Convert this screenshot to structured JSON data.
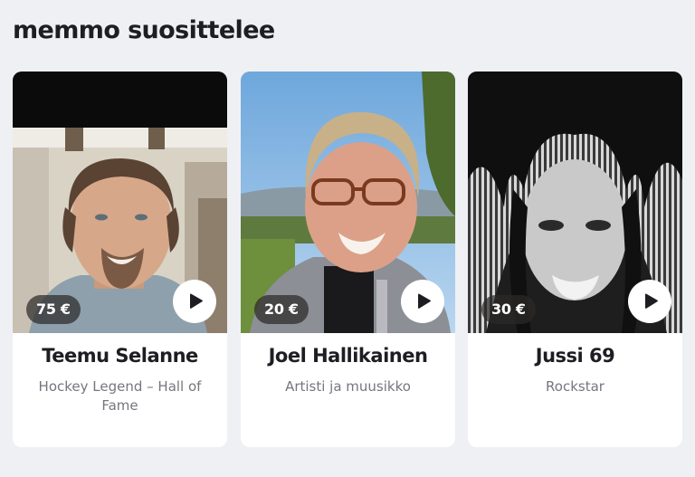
{
  "section": {
    "title": "memmo suosittelee"
  },
  "cards": [
    {
      "name": "Teemu Selanne",
      "subtitle": "Hockey Legend – Hall of Fame",
      "price": "75 €",
      "play_icon": "play-icon"
    },
    {
      "name": "Joel Hallikainen",
      "subtitle": "Artisti ja muusikko",
      "price": "20 €",
      "play_icon": "play-icon"
    },
    {
      "name": "Jussi 69",
      "subtitle": "Rockstar",
      "price": "30 €",
      "play_icon": "play-icon"
    }
  ],
  "colors": {
    "background": "#eff0f4",
    "card": "#ffffff",
    "title_text": "#1d1d22",
    "subtitle_text": "#76767e",
    "price_badge": "#2d2a28"
  }
}
